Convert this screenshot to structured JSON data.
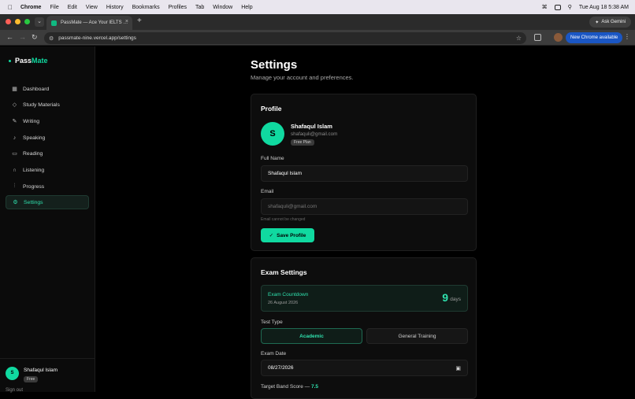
{
  "os_menubar": {
    "app_name": "Chrome",
    "items": [
      "File",
      "Edit",
      "View",
      "History",
      "Bookmarks",
      "Profiles",
      "Tab",
      "Window",
      "Help"
    ],
    "datetime": "Tue Aug 18  5:38 AM"
  },
  "browser": {
    "tab_title": "PassMate — Ace Your IELTS …",
    "new_tab_symbol": "+",
    "ask_gemini_label": "Ask Gemini",
    "url": "passmate-nine.vercel.app/settings",
    "new_chrome_label": "New Chrome available"
  },
  "sidebar": {
    "logo_part1": "Pass",
    "logo_part2": "Mate",
    "items": [
      {
        "label": "Dashboard",
        "icon": "grid-icon"
      },
      {
        "label": "Study Materials",
        "icon": "graduation-cap-icon"
      },
      {
        "label": "Writing",
        "icon": "pen-icon"
      },
      {
        "label": "Speaking",
        "icon": "mic-icon"
      },
      {
        "label": "Reading",
        "icon": "book-icon"
      },
      {
        "label": "Listening",
        "icon": "headphones-icon"
      },
      {
        "label": "Progress",
        "icon": "bar-chart-icon"
      },
      {
        "label": "Settings",
        "icon": "gear-icon",
        "active": true
      }
    ],
    "user": {
      "initial": "S",
      "name": "Shafaqul Islam",
      "plan": "Free"
    },
    "sign_out": "Sign out"
  },
  "page": {
    "title": "Settings",
    "subtitle": "Manage your account and preferences."
  },
  "profile": {
    "heading": "Profile",
    "initial": "S",
    "name": "Shafaqul Islam",
    "email": "shafaquli@gmail.com",
    "plan_badge": "Free Plan",
    "full_name_label": "Full Name",
    "full_name_value": "Shafaqul Islam",
    "email_label": "Email",
    "email_value": "shafaquli@gmail.com",
    "email_hint": "Email cannot be changed",
    "save_label": "Save Profile"
  },
  "exam": {
    "heading": "Exam Settings",
    "countdown_label": "Exam Countdown",
    "countdown_date": "26 August 2026",
    "countdown_days": "9",
    "countdown_unit": "days",
    "test_type_label": "Test Type",
    "test_type_options": [
      "Academic",
      "General Training"
    ],
    "selected_test_type": "Academic",
    "exam_date_label": "Exam Date",
    "exam_date_value": "08/27/2026",
    "target_band_label": "Target Band Score —",
    "target_band_value": "7.5"
  },
  "colors": {
    "accent": "#10d9a0",
    "background": "#000000",
    "card": "#0d0d0d"
  }
}
